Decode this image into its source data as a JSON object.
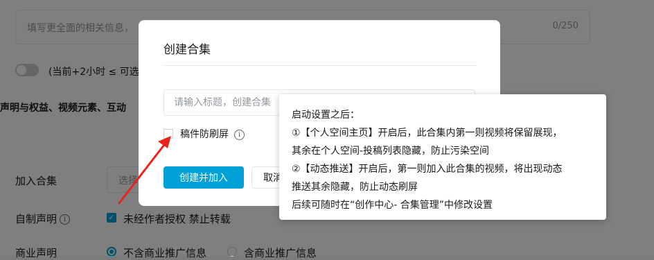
{
  "background": {
    "description_input": {
      "placeholder": "填写更全面的相关信息，",
      "counter": "0/250"
    },
    "schedule_toggle_label": "(当前+2小时 ≤ 可选",
    "section_heading": "声明与权益、视频元素、互动",
    "collection_row": {
      "label": "加入合集",
      "select_placeholder": "选择"
    },
    "original_row": {
      "label": "自制声明",
      "checkbox_label": "未经作者授权 禁止转载"
    },
    "commercial_row": {
      "label": "商业声明",
      "option_1": "不含商业推广信息",
      "option_2": "含商业推广信息"
    }
  },
  "modal": {
    "title": "创建合集",
    "title_input_placeholder": "请输入标题，创建合集",
    "anti_refresh_label": "稿件防刷屏",
    "create_button": "创建并加入",
    "cancel_button": "取消"
  },
  "tooltip": {
    "lines": [
      "启动设置之后：",
      "①【个人空间主页】开启后，此合集内第一则视频将保留展现，",
      "其余在个人空间-投稿列表隐藏，防止污染空间",
      "②【动态推送】开启后，第一则加入此合集的视频，将出现动态",
      "推送其余隐藏，防止动态刷屏",
      "后续可随时在“创作中心- 合集管理”中修改设置"
    ]
  },
  "colors": {
    "accent": "#00a1d6",
    "annotation": "#e8231c",
    "overlay": "rgba(0,0,0,0.5)"
  }
}
